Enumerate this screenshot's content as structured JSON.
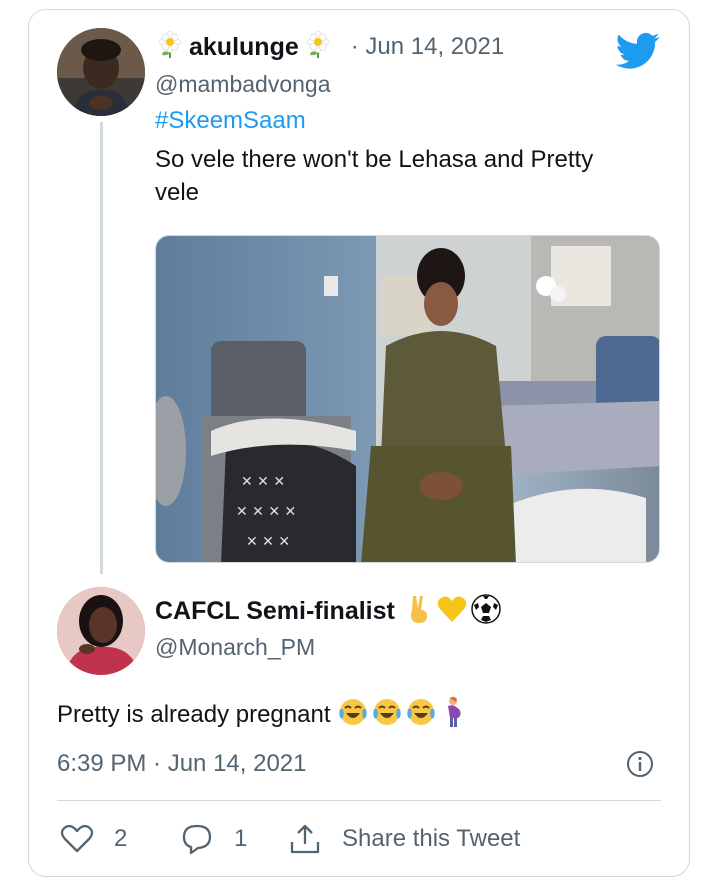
{
  "quoted_tweet": {
    "display_name": "akulunge",
    "handle": "@mambadvonga",
    "date": "· Jun 14, 2021",
    "hashtag": "#SkeemSaam",
    "text": "So vele there won't be Lehasa and Pretty vele",
    "name_emoji_icon": "flower-icon"
  },
  "reply": {
    "display_name": "CAFCL Semi-finalist",
    "handle": "@Monarch_PM",
    "text": "Pretty is already pregnant",
    "name_badges": [
      "victory-hand-icon",
      "yellow-heart-icon",
      "soccer-ball-icon"
    ],
    "text_emojis": [
      "tears-of-joy-icon",
      "tears-of-joy-icon",
      "tears-of-joy-icon",
      "pregnant-woman-icon"
    ],
    "timestamp": "6:39 PM · Jun 14, 2021"
  },
  "actions": {
    "likes": "2",
    "replies": "1",
    "share_label": "Share this Tweet"
  },
  "colors": {
    "twitter_blue": "#1d9bf0",
    "text_primary": "#0f1419",
    "text_secondary": "#536471",
    "border": "#cfd9de"
  }
}
